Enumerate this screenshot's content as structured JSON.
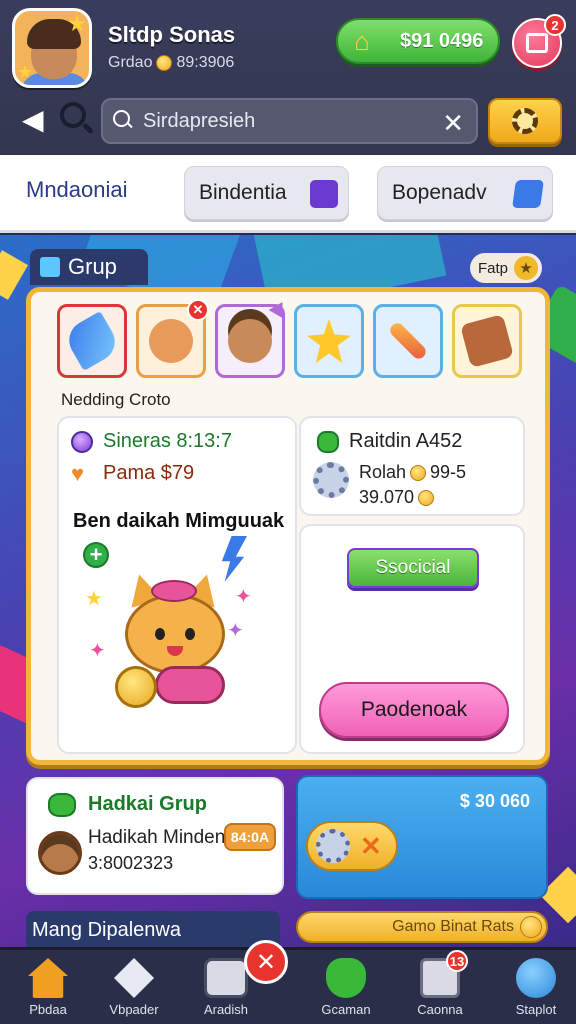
{
  "header": {
    "player_name": "Sltdp Sonas",
    "player_sub_label": "Grdao",
    "player_sub_value": "89:3906",
    "currency_value": "$91 0496",
    "store_badge": "2",
    "search_placeholder": "Sirdapresieh"
  },
  "tabs": {
    "main": "Mndaoniai",
    "chip1": "Bindentia",
    "chip2": "Bopenadv"
  },
  "group": {
    "tab_label": "Grup",
    "fatp_label": "Fatp",
    "items_label": "Nedding Croto",
    "left_card": {
      "line1": "Sineras 8:13:7",
      "line2": "Pama $79",
      "headline": "Ben daikah Mimguuak"
    },
    "right_card": {
      "title": "Raitdin A452",
      "line1": "Rolah",
      "line1_value": "99-5",
      "line2": "39.070"
    },
    "special_button": "Ssocicial",
    "pink_button": "Paodenoak"
  },
  "hadikai": {
    "title": "Hadkai Grup",
    "name": "Hadikah Minden",
    "number": "3:8002323",
    "badge": "84:0A"
  },
  "bluebox": {
    "amount": "$ 30 060"
  },
  "mang_label": "Mang Dipalenwa",
  "gamebar_label": "Gamo Binat Rats",
  "nav": {
    "items": [
      {
        "label": "Pbdaa"
      },
      {
        "label": "Vbpader"
      },
      {
        "label": "Aradish"
      },
      {
        "label": "Gcaman"
      },
      {
        "label": "Caonna"
      },
      {
        "label": "Staplot"
      }
    ],
    "badge": "13"
  },
  "colors": {
    "accent_gold": "#f0b63a",
    "accent_green": "#3fb43a",
    "accent_pink": "#f062b8",
    "header_bg": "#33364f"
  }
}
